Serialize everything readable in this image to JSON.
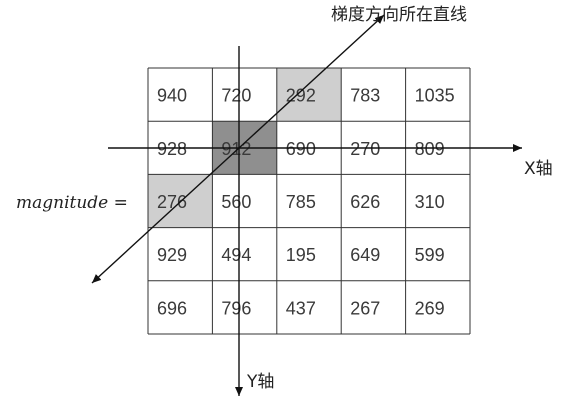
{
  "grid": {
    "rows": [
      [
        "940",
        "720",
        "292",
        "783",
        "1035"
      ],
      [
        "928",
        "912",
        "690",
        "270",
        "809"
      ],
      [
        "276",
        "560",
        "785",
        "626",
        "310"
      ],
      [
        "929",
        "494",
        "195",
        "649",
        "599"
      ],
      [
        "696",
        "796",
        "437",
        "267",
        "269"
      ]
    ],
    "highlights": [
      {
        "row": 0,
        "col": 2,
        "color": "#cfcfcf"
      },
      {
        "row": 1,
        "col": 1,
        "color": "#8f8f8f"
      },
      {
        "row": 2,
        "col": 0,
        "color": "#cfcfcf"
      }
    ]
  },
  "labels": {
    "gradient_line": "梯度方向所在直线",
    "x_axis": "X轴",
    "y_axis": "Y轴",
    "magnitude": "magnitude ="
  }
}
